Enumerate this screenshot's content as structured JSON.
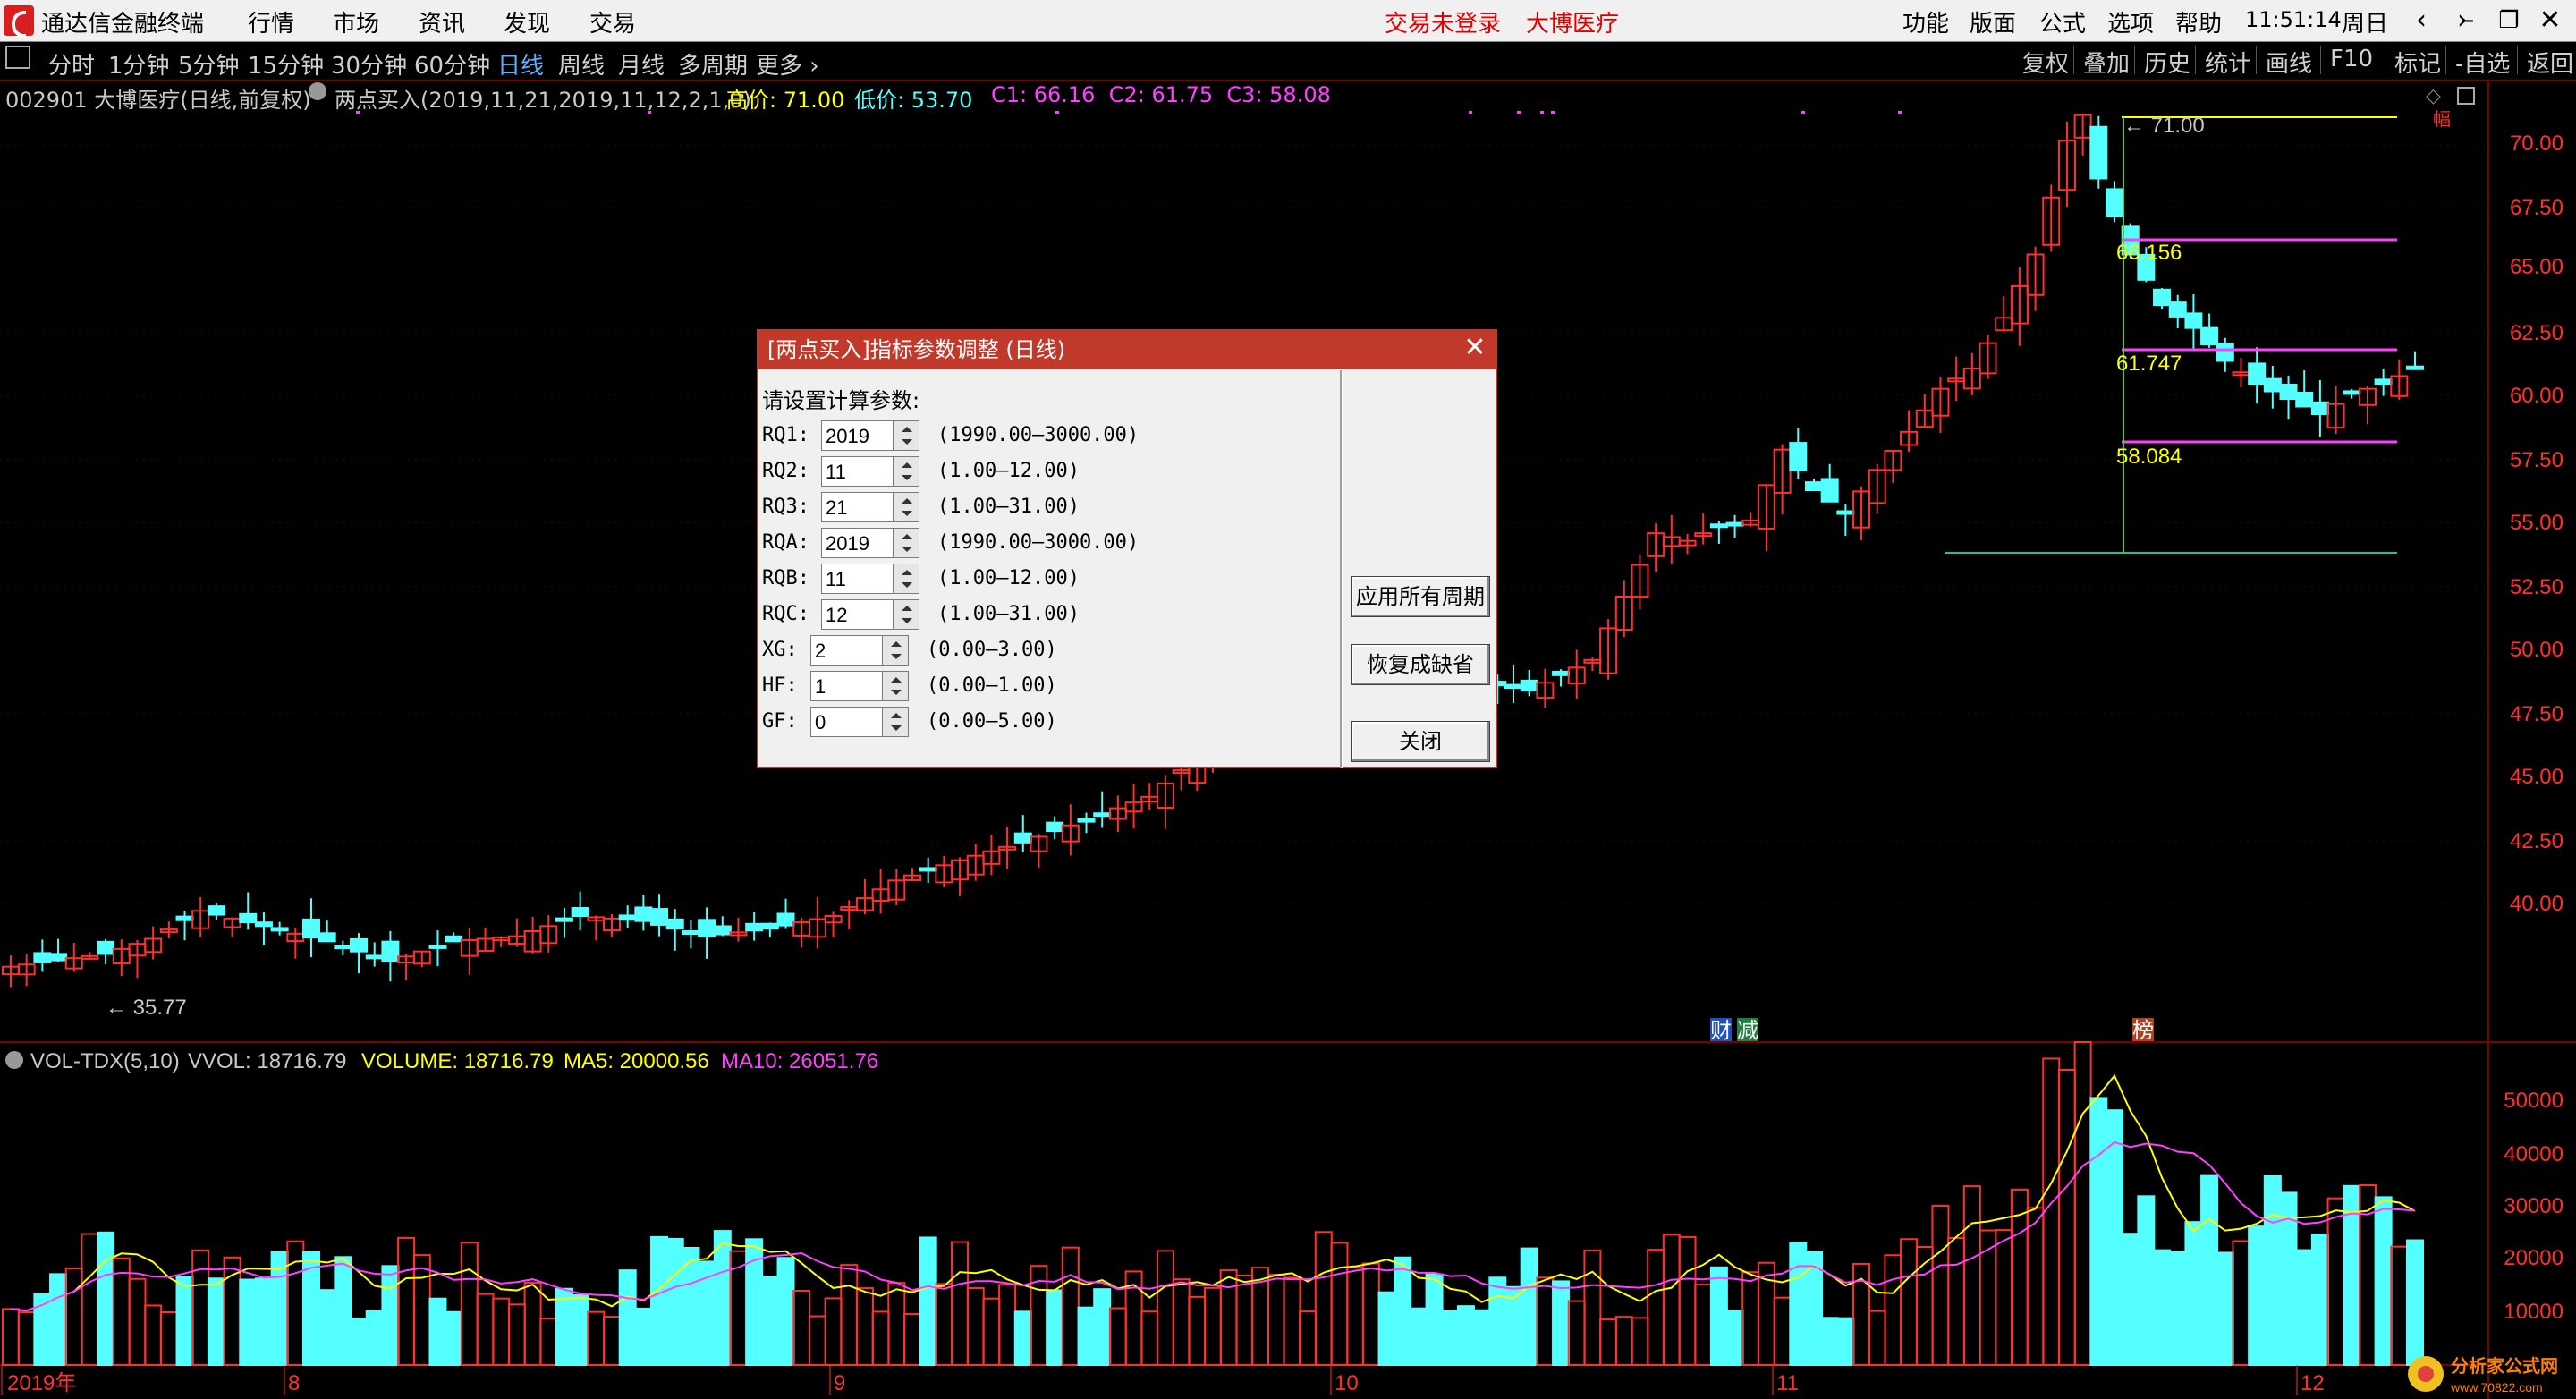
{
  "menubar": {
    "app_name": "通达信金融终端",
    "menus": [
      "行情",
      "市场",
      "资讯",
      "发现",
      "交易"
    ],
    "login_status": "交易未登录",
    "stock_name": "大博医疗",
    "right_menus": [
      "功能",
      "版面",
      "公式",
      "选项",
      "帮助"
    ],
    "time": "11:51:14",
    "weekday": "周日"
  },
  "toolbar": {
    "periods": [
      "分时",
      "1分钟",
      "5分钟",
      "15分钟",
      "30分钟",
      "60分钟",
      "日线",
      "周线",
      "月线",
      "多周期",
      "更多"
    ],
    "active_period": "日线",
    "right_buttons": [
      "复权",
      "叠加",
      "历史",
      "统计",
      "画线",
      "F10",
      "标记",
      "-自选",
      "返回"
    ]
  },
  "info": {
    "code_name": "002901 大博医疗(日线,前复权)",
    "indicator": "两点买入(2019,11,21,2019,11,12,2,1,0)",
    "high": "高价: 71.00",
    "low": "低价: 53.70",
    "c_values": "C1: 66.16  C2: 61.75  C3: 58.08"
  },
  "main_chart": {
    "yticks": [
      "70.00",
      "67.50",
      "65.00",
      "62.50",
      "60.00",
      "57.50",
      "55.00",
      "52.50",
      "50.00",
      "47.50",
      "45.00",
      "42.50",
      "40.00"
    ],
    "high_label": "71.00",
    "low_label": "35.77",
    "levels": {
      "c1": "66.156",
      "c2": "61.747",
      "c3": "58.084"
    },
    "markers": [
      "财",
      "减",
      "榜"
    ],
    "top_right_label": "幅"
  },
  "volume": {
    "header": "VOL-TDX(5,10)",
    "vvol": "VVOL: 18716.79",
    "volume": "VOLUME: 18716.79",
    "ma5": "MA5: 20000.56",
    "ma10": "MA10: 26051.76",
    "yticks": [
      "50000",
      "40000",
      "30000",
      "20000",
      "10000"
    ]
  },
  "xaxis": {
    "labels": [
      "2019年",
      "8",
      "9",
      "10",
      "11",
      "12"
    ]
  },
  "watermark": {
    "text": "分析家公式网",
    "url": "www.70822.com"
  },
  "dialog": {
    "title": "[两点买入]指标参数调整 (日线)",
    "prompt": "请设置计算参数:",
    "params": [
      {
        "label": "RQ1:",
        "value": "2019",
        "range": "(1990.00—3000.00)"
      },
      {
        "label": "RQ2:",
        "value": "11",
        "range": "(1.00—12.00)"
      },
      {
        "label": "RQ3:",
        "value": "21",
        "range": "(1.00—31.00)"
      },
      {
        "label": "RQA:",
        "value": "2019",
        "range": "(1990.00—3000.00)"
      },
      {
        "label": "RQB:",
        "value": "11",
        "range": "(1.00—12.00)"
      },
      {
        "label": "RQC:",
        "value": "12",
        "range": "(1.00—31.00)"
      },
      {
        "label": "XG:",
        "value": "2",
        "range": "(0.00—3.00)"
      },
      {
        "label": "HF:",
        "value": "1",
        "range": "(0.00—1.00)"
      },
      {
        "label": "GF:",
        "value": "0",
        "range": "(0.00—5.00)"
      }
    ],
    "apply_all": "应用所有周期",
    "restore": "恢复成缺省",
    "close": "关闭"
  },
  "colors": {
    "up": "#ff3030",
    "down": "#54ffff",
    "ma5": "#ffff00",
    "ma10": "#ff40ff",
    "border": "#7a0000"
  }
}
